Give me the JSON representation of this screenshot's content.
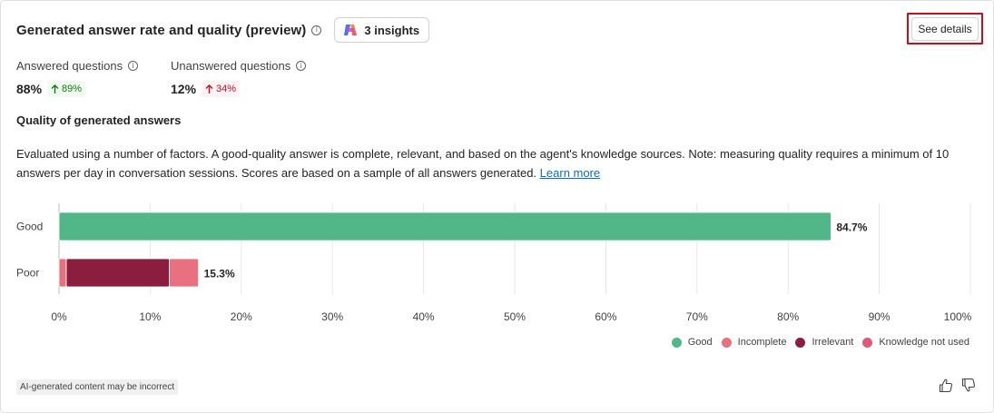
{
  "header": {
    "title": "Generated answer rate and quality (preview)",
    "info_icon": "info-icon",
    "insights_label": "3 insights",
    "insights_icon": "copilot-icon",
    "see_details_label": "See details"
  },
  "metrics": [
    {
      "label": "Answered questions",
      "value": "88%",
      "delta": "89%",
      "delta_direction": "up",
      "delta_color": "#107c10"
    },
    {
      "label": "Unanswered questions",
      "value": "12%",
      "delta": "34%",
      "delta_direction": "up",
      "delta_color": "#c50f1f"
    }
  ],
  "quality": {
    "title": "Quality of generated answers",
    "description": "Evaluated using a number of factors. A good-quality answer is complete, relevant, and based on the agent's knowledge sources. Note: measuring quality requires a minimum of 10 answers per day in conversation sessions. Scores are based on a sample of all answers generated.",
    "learn_more": "Learn more"
  },
  "chart_data": {
    "type": "bar",
    "orientation": "horizontal",
    "stacked": true,
    "categories": [
      "Good",
      "Poor"
    ],
    "series": [
      {
        "name": "Good",
        "color": "#52b788",
        "values": [
          84.7,
          0
        ]
      },
      {
        "name": "Incomplete",
        "color": "#e8707f",
        "values": [
          0,
          0.8
        ]
      },
      {
        "name": "Irrelevant",
        "color": "#8b1d3e",
        "values": [
          0,
          11.3
        ]
      },
      {
        "name": "Knowledge not used",
        "color": "#e8707f",
        "values": [
          0,
          3.2
        ]
      }
    ],
    "totals": [
      "84.7%",
      "15.3%"
    ],
    "xlim": [
      0,
      100
    ],
    "xticks": [
      "0%",
      "10%",
      "20%",
      "30%",
      "40%",
      "50%",
      "60%",
      "70%",
      "80%",
      "90%",
      "100%"
    ],
    "grid": true,
    "legend_placement": "bottom-right"
  },
  "legend": [
    {
      "label": "Good",
      "color": "#52b788"
    },
    {
      "label": "Incomplete",
      "color": "#e8707f"
    },
    {
      "label": "Irrelevant",
      "color": "#8b1d3e"
    },
    {
      "label": "Knowledge not used",
      "color": "#df5a78"
    }
  ],
  "footer": {
    "ai_note": "AI-generated content may be incorrect",
    "thumbs_up_icon": "thumbs-up-icon",
    "thumbs_down_icon": "thumbs-down-icon"
  }
}
